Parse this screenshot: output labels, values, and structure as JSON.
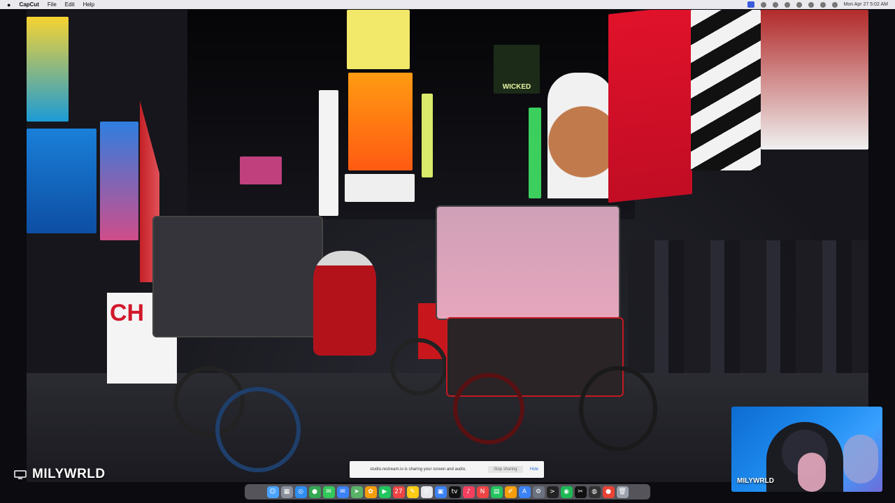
{
  "menubar": {
    "app_name": "CapCut",
    "menus": [
      "File",
      "Edit",
      "Help"
    ],
    "datetime": "Mon Apr 27  5:02 AM"
  },
  "video": {
    "sign_text": "CH",
    "billboard_text": "WICKED"
  },
  "streamer": {
    "name": "MILYWRLD",
    "cam_label": "MILYWRLD"
  },
  "screen_share": {
    "message": "studio.restream.io is sharing your screen and audio.",
    "stop_label": "Stop sharing",
    "hide_label": "Hide"
  },
  "dock": {
    "icons": [
      {
        "name": "finder-icon",
        "color": "#4aa3ff",
        "glyph": "☺"
      },
      {
        "name": "launchpad-icon",
        "color": "#8a8f9c",
        "glyph": "▦"
      },
      {
        "name": "safari-icon",
        "color": "#2d8cf0",
        "glyph": "◎"
      },
      {
        "name": "chrome-icon",
        "color": "#34a853",
        "glyph": "●"
      },
      {
        "name": "messages-icon",
        "color": "#33c85a",
        "glyph": "✉"
      },
      {
        "name": "mail-icon",
        "color": "#3b82f6",
        "glyph": "✉"
      },
      {
        "name": "maps-icon",
        "color": "#58b368",
        "glyph": "➤"
      },
      {
        "name": "photos-icon",
        "color": "#f59e0b",
        "glyph": "✿"
      },
      {
        "name": "facetime-icon",
        "color": "#22c55e",
        "glyph": "▶"
      },
      {
        "name": "calendar-icon",
        "color": "#ef4444",
        "glyph": "27"
      },
      {
        "name": "notes-icon",
        "color": "#facc15",
        "glyph": "✎"
      },
      {
        "name": "reminders-icon",
        "color": "#e5e7eb",
        "glyph": "☰"
      },
      {
        "name": "keynote-icon",
        "color": "#3b82f6",
        "glyph": "▣"
      },
      {
        "name": "appletv-icon",
        "color": "#111111",
        "glyph": "tv"
      },
      {
        "name": "music-icon",
        "color": "#f43f5e",
        "glyph": "♪"
      },
      {
        "name": "news-icon",
        "color": "#ef4444",
        "glyph": "N"
      },
      {
        "name": "numbers-icon",
        "color": "#22c55e",
        "glyph": "▤"
      },
      {
        "name": "pages-icon",
        "color": "#f59e0b",
        "glyph": "✐"
      },
      {
        "name": "appstore-icon",
        "color": "#3b82f6",
        "glyph": "A"
      },
      {
        "name": "settings-icon",
        "color": "#6b7280",
        "glyph": "⚙"
      },
      {
        "name": "terminal-icon",
        "color": "#222222",
        "glyph": ">"
      },
      {
        "name": "spotify-icon",
        "color": "#1db954",
        "glyph": "◉"
      },
      {
        "name": "capcut-icon",
        "color": "#111111",
        "glyph": "✂"
      },
      {
        "name": "obs-icon",
        "color": "#333333",
        "glyph": "◍"
      },
      {
        "name": "chrome2-icon",
        "color": "#ea4335",
        "glyph": "●"
      },
      {
        "name": "trash-icon",
        "color": "#9ca3af",
        "glyph": "🗑"
      }
    ]
  }
}
